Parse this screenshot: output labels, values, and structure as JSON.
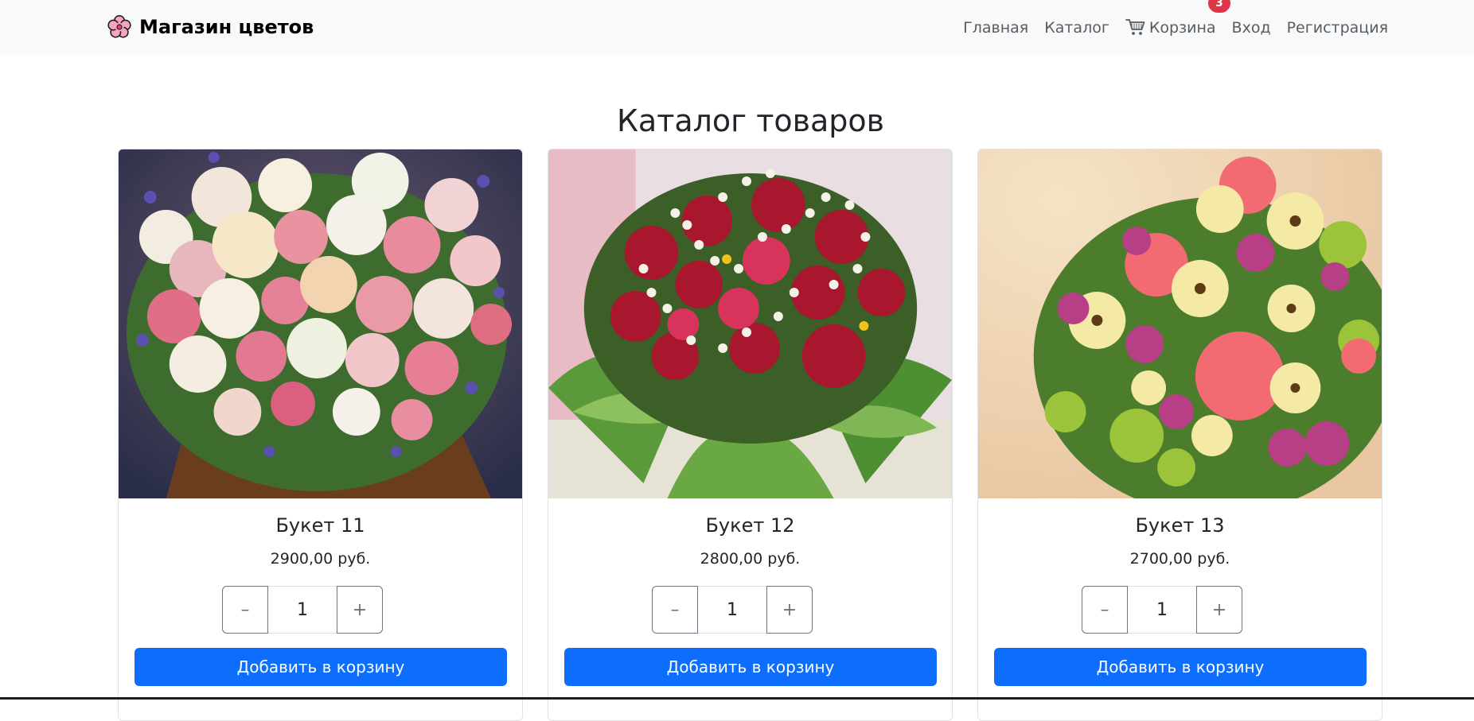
{
  "brand": {
    "name": "Магазин цветов",
    "icon": "flower-icon"
  },
  "nav": {
    "home": "Главная",
    "catalog": "Каталог",
    "cart": "Корзина",
    "cart_count": "3",
    "login": "Вход",
    "register": "Регистрация"
  },
  "page": {
    "title": "Каталог товаров"
  },
  "products": [
    {
      "name": "Букет 11",
      "price": "2900,00 руб.",
      "qty": "1",
      "minus": "–",
      "plus": "+",
      "add": "Добавить в корзину"
    },
    {
      "name": "Букет 12",
      "price": "2800,00 руб.",
      "qty": "1",
      "minus": "–",
      "plus": "+",
      "add": "Добавить в корзину"
    },
    {
      "name": "Букет 13",
      "price": "2700,00 руб.",
      "qty": "1",
      "minus": "–",
      "plus": "+",
      "add": "Добавить в корзину"
    }
  ],
  "colors": {
    "primary": "#0d6efd",
    "badge": "#dc3545",
    "navbar_bg": "#f8f9fa"
  }
}
